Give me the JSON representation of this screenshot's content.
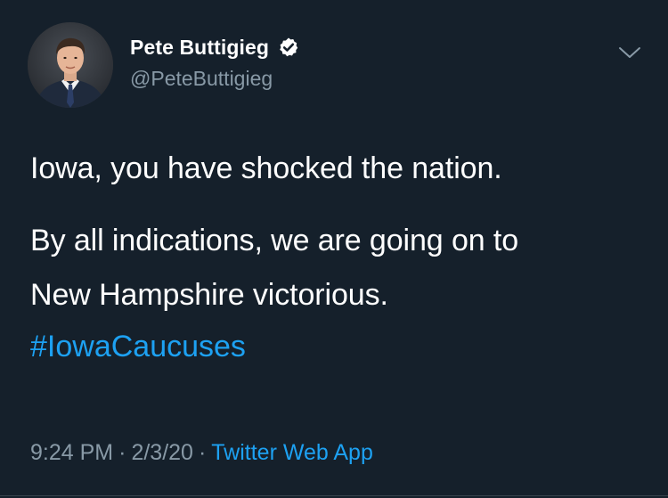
{
  "tweet": {
    "author": {
      "display_name": "Pete Buttigieg",
      "handle": "@PeteButtigieg",
      "verified": true,
      "avatar_icon": "profile-photo"
    },
    "text_lines": [
      "Iowa, you have shocked the nation.",
      "By all indications, we are going on to",
      "New Hampshire victorious."
    ],
    "hashtag": "#IowaCaucuses",
    "meta": {
      "time": "9:24 PM",
      "separator": "·",
      "date": "2/3/20",
      "source": "Twitter Web App"
    },
    "menu_icon": "chevron-down-icon"
  },
  "colors": {
    "background": "#15202b",
    "text": "#ffffff",
    "secondary": "#8899a6",
    "link": "#1da1f2"
  }
}
